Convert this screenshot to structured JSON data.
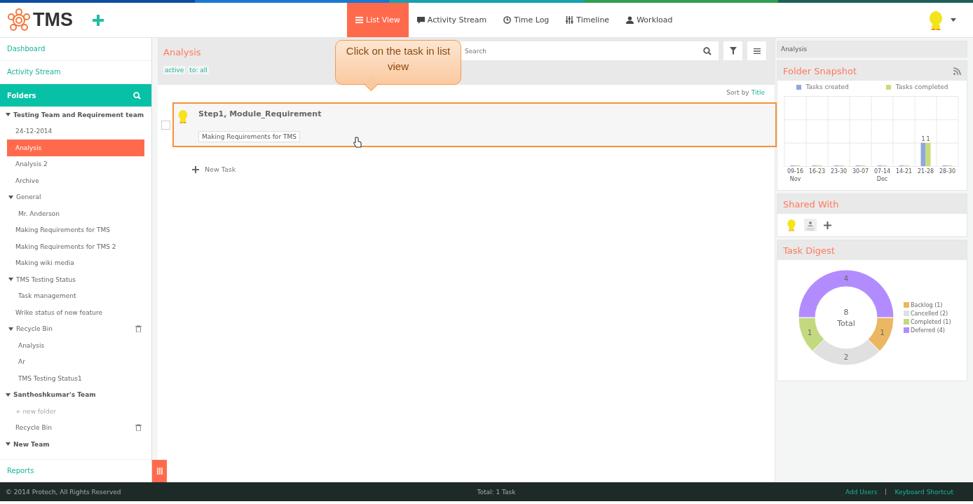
{
  "header": {
    "logo": "TMS",
    "tabs": [
      {
        "label": "List View",
        "selected": true
      },
      {
        "label": "Activity Stream",
        "selected": false
      },
      {
        "label": "Time Log",
        "selected": false
      },
      {
        "label": "Timeline",
        "selected": false
      },
      {
        "label": "Workload",
        "selected": false
      }
    ]
  },
  "sidebar": {
    "nav": [
      "Dashboard",
      "Activity Stream"
    ],
    "folders_title": "Folders",
    "tree": [
      {
        "label": "Testing Team and Requirement team",
        "kind": "team",
        "selected": false,
        "expanded": true,
        "children": [
          {
            "label": "24-12-2014",
            "kind": "folder",
            "selected": false
          },
          {
            "label": "Analysis",
            "kind": "folder",
            "selected": true
          },
          {
            "label": "Analysis 2",
            "kind": "folder",
            "selected": false
          },
          {
            "label": "Archive",
            "kind": "folder",
            "selected": false
          },
          {
            "label": "General",
            "kind": "folder",
            "selected": false,
            "expanded": true,
            "children": [
              {
                "label": "Mr. Anderson",
                "kind": "folder",
                "selected": false
              }
            ]
          },
          {
            "label": "Making Requirements for TMS",
            "kind": "folder",
            "selected": false
          },
          {
            "label": "Making Requirements for TMS 2",
            "kind": "folder",
            "selected": false
          },
          {
            "label": "Making wiki media",
            "kind": "folder",
            "selected": false
          },
          {
            "label": "TMS Testing Status",
            "kind": "folder",
            "selected": false,
            "expanded": true,
            "children": [
              {
                "label": "Task management",
                "kind": "folder",
                "selected": false
              }
            ]
          },
          {
            "label": "Wrike status of new feature",
            "kind": "folder",
            "selected": false
          },
          {
            "label": "Recycle Bin",
            "kind": "bin",
            "selected": false,
            "expanded": true,
            "children": [
              {
                "label": "Analysis",
                "kind": "folder",
                "selected": false
              },
              {
                "label": "Ar",
                "kind": "folder",
                "selected": false
              },
              {
                "label": "TMS Testing Status1",
                "kind": "folder",
                "selected": false
              }
            ]
          }
        ]
      },
      {
        "label": "Santhoshkumar's Team",
        "kind": "team",
        "selected": false,
        "expanded": true,
        "children": [
          {
            "label": "+ new folder",
            "kind": "add",
            "selected": false
          },
          {
            "label": "Recycle Bin",
            "kind": "bin",
            "selected": false
          }
        ]
      },
      {
        "label": "New Team",
        "kind": "team",
        "selected": false,
        "expanded": true
      }
    ],
    "reports": "Reports"
  },
  "main": {
    "title": "Analysis",
    "filters": [
      "active",
      "to: all"
    ],
    "search": {
      "placeholder": "Search"
    },
    "sort_label": "Sort by",
    "sort_value": "Title",
    "tasks": [
      {
        "title": "Step1, Module_Requirement",
        "tag": "Making Requirements for TMS",
        "checked": false,
        "highlighted": true
      }
    ],
    "new_task": "New Task",
    "callout": "Click on the task in list view"
  },
  "right": {
    "breadcrumb": "Analysis",
    "snapshot": {
      "title": "Folder Snapshot",
      "chart_data": {
        "type": "bar",
        "categories": [
          "09-16\nNov",
          "16-23",
          "23-30",
          "30-07",
          "07-14\nDec",
          "14-21",
          "21-28",
          "28-30"
        ],
        "series": [
          {
            "name": "Tasks created",
            "color": "#8fa8d8",
            "values": [
              0,
              0,
              0,
              0,
              0,
              0,
              1,
              0
            ],
            "value_labels": [
              null,
              null,
              null,
              null,
              null,
              null,
              "1",
              null
            ]
          },
          {
            "name": "Tasks completed",
            "color": "#c8dd7a",
            "values": [
              0,
              0,
              0,
              0,
              0,
              0,
              1,
              0
            ],
            "value_labels": [
              null,
              null,
              null,
              null,
              null,
              null,
              "1",
              null
            ]
          }
        ]
      }
    },
    "shared": {
      "title": "Shared With"
    },
    "digest": {
      "title": "Task Digest",
      "chart_data": {
        "type": "donut",
        "categories": [
          "Backlog (1)",
          "Cancelled (2)",
          "Completed (1)",
          "Deferred (4)"
        ],
        "values": [
          1,
          2,
          1,
          4
        ],
        "colors": [
          "#ebb762",
          "#e0e0e0",
          "#c3d97f",
          "#b28cff"
        ],
        "data_labels": true,
        "annotations": [
          {
            "text": "8"
          },
          {
            "text": "Total"
          }
        ]
      }
    }
  },
  "footer": {
    "copyright": "© 2014 Protech, All Rights Reserved",
    "total": "Total: 1 Task",
    "links": [
      "Add Users",
      "Keyboard Shortcut"
    ]
  }
}
